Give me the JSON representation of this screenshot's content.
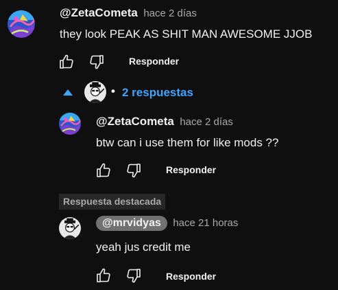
{
  "colors": {
    "background": "#0f0f0f",
    "link": "#3ea6ff",
    "muted": "#aaaaaa",
    "text": "#f1f1f1"
  },
  "top_comment": {
    "author": "@ZetaCometa",
    "time": "hace 2 días",
    "text": "they look PEAK AS SHIT MAN AWESOME JJOB",
    "reply_label": "Responder",
    "avatar_icon": "zeta-avatar-icon"
  },
  "replies_toggle": {
    "label": "2 respuestas",
    "separator": "•",
    "icon": "caret-up-icon"
  },
  "replies": [
    {
      "author": "@ZetaCometa",
      "time": "hace 2 días",
      "text": "btw can i use them for like mods ??",
      "reply_label": "Responder",
      "avatar_icon": "zeta-avatar-icon"
    },
    {
      "badge": "Respuesta destacada",
      "author": "@mrvidyas",
      "time": "hace 21 horas",
      "text": "yeah jus credit me",
      "reply_label": "Responder",
      "avatar_icon": "mrvidyas-avatar-icon"
    }
  ]
}
